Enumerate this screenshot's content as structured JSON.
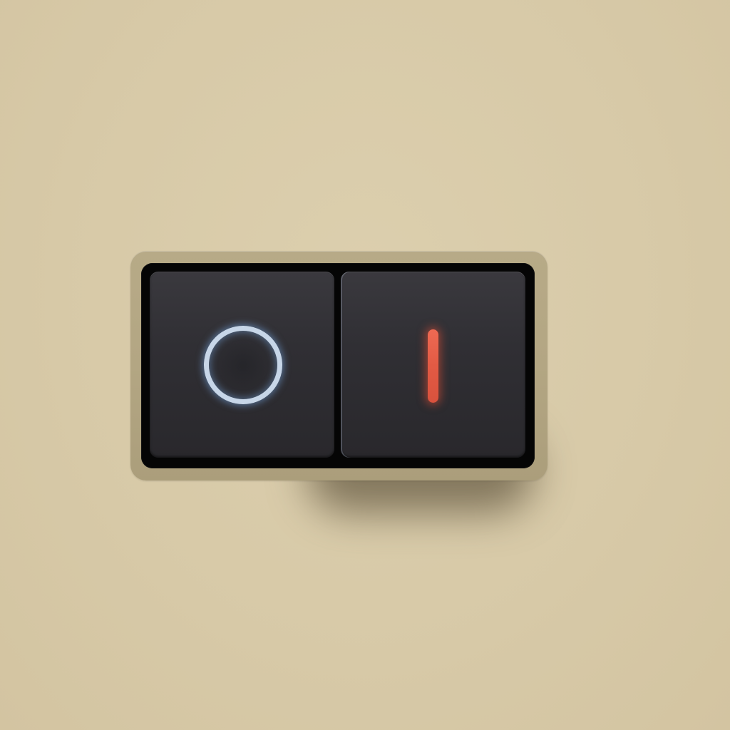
{
  "switch": {
    "state": "on",
    "off_segment": {
      "icon": "off-ring-icon",
      "glow_color": "#7aaae6",
      "ring_color": "#c7d6e8"
    },
    "on_segment": {
      "icon": "on-bar-icon",
      "glow_color": "#e6503a",
      "bar_color": "#e25a44"
    }
  },
  "colors": {
    "background": "#d8caa8",
    "bezel": "#b3a683",
    "housing": "#050505",
    "rocker": "#302f34"
  }
}
